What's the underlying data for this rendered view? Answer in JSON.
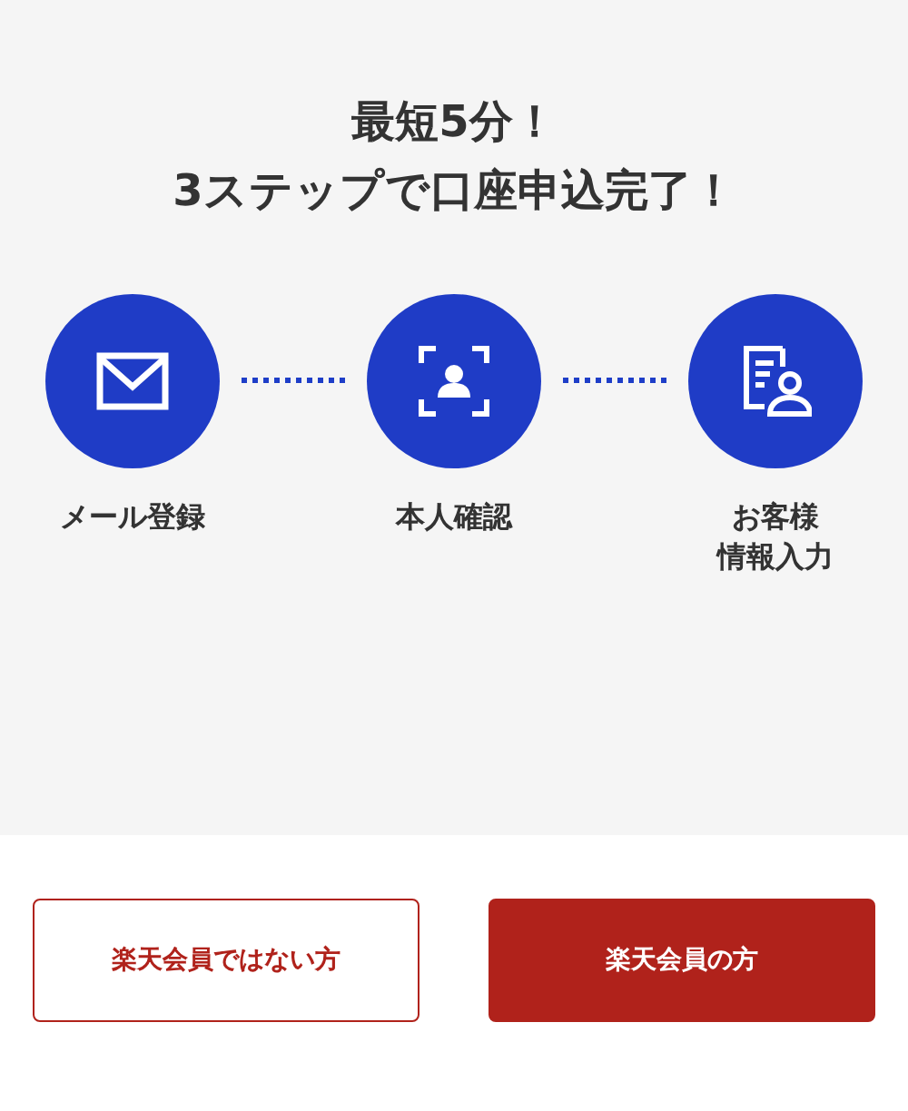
{
  "headline": [
    "最短5分！",
    "3ステップで口座申込完了！"
  ],
  "steps": [
    {
      "kind": "mail",
      "label_lines": [
        "メール登録"
      ]
    },
    {
      "kind": "face",
      "label_lines": [
        "本人確認"
      ]
    },
    {
      "kind": "form",
      "label_lines": [
        "お客様",
        "情報入力"
      ]
    }
  ],
  "buttons": [
    {
      "kind": "outline",
      "label": "楽天会員ではない方"
    },
    {
      "kind": "filled",
      "label": "楽天会員の方"
    }
  ]
}
